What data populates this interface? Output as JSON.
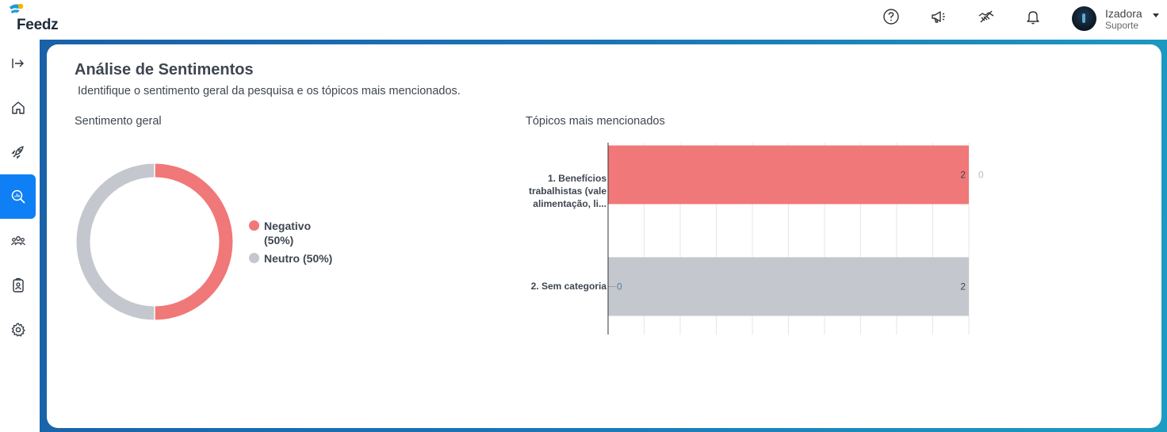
{
  "app": {
    "brand": "Feedz"
  },
  "header": {
    "icons": [
      "help-circle-icon",
      "megaphone-icon",
      "handshake-icon",
      "bell-icon"
    ],
    "user": {
      "name": "Izadora",
      "role": "Suporte"
    }
  },
  "sidebar": {
    "items": [
      {
        "icon": "expand-sidebar-icon",
        "active": false
      },
      {
        "icon": "home-icon",
        "active": false
      },
      {
        "icon": "rocket-icon",
        "active": false
      },
      {
        "icon": "analytics-search-icon",
        "active": true
      },
      {
        "icon": "people-icon",
        "active": false
      },
      {
        "icon": "badge-icon",
        "active": false
      },
      {
        "icon": "gear-icon",
        "active": false
      }
    ]
  },
  "page": {
    "title": "Análise de Sentimentos",
    "subtitle": "Identifique o sentimento geral da pesquisa e os tópicos mais mencionados."
  },
  "sentiment": {
    "label": "Sentimento geral",
    "legend": [
      {
        "label": "Negativo (50%)",
        "color": "#f07878"
      },
      {
        "label": "Neutro (50%)",
        "color": "#c4c7cd"
      }
    ]
  },
  "topics": {
    "label": "Tópicos mais mencionados"
  },
  "chart_data": [
    {
      "type": "pie",
      "variant": "donut",
      "title": "Sentimento geral",
      "categories": [
        "Negativo",
        "Neutro"
      ],
      "values": [
        50,
        50
      ],
      "colors": [
        "#f07878",
        "#c4c7cd"
      ],
      "legend_position": "right"
    },
    {
      "type": "bar",
      "orientation": "horizontal",
      "stacked": true,
      "title": "Tópicos mais mencionados",
      "categories": [
        "1. Benefícios trabalhistas (vale alimentação, li...",
        "2. Sem categoria"
      ],
      "series": [
        {
          "values": [
            2,
            0
          ],
          "color": "#f07878"
        },
        {
          "values": [
            0,
            2
          ],
          "color": "#c4c7cd"
        }
      ],
      "xlim": [
        0,
        2
      ],
      "grid": true
    }
  ]
}
